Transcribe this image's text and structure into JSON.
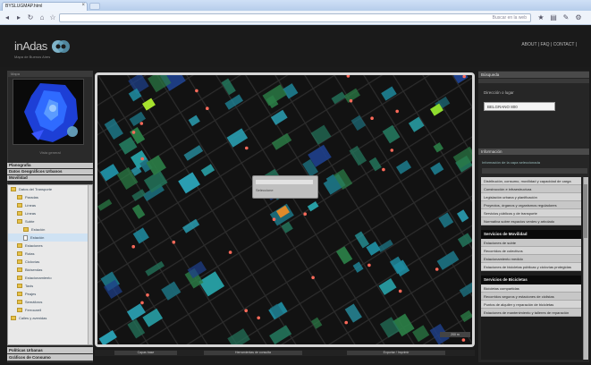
{
  "browser": {
    "tab_title": "BYSLUGMAP.html",
    "url_hint": "Buscar en la web"
  },
  "site": {
    "logo": "inAdas",
    "tagline": "Mapa de Buenos Aires",
    "nav": "ABOUT | FAQ | CONTACT |"
  },
  "left": {
    "minimap_header": "Mapa",
    "minimap_caption": "Vista general",
    "sections": [
      "Planografía",
      "Datos Geográficos Urbanos",
      "Movilidad"
    ],
    "tree": [
      {
        "label": "Datos del Transporte",
        "kind": "folder",
        "indent": 0
      },
      {
        "label": "Paradas",
        "kind": "folder",
        "indent": 1
      },
      {
        "label": "Líneas",
        "kind": "folder",
        "indent": 1
      },
      {
        "label": "Líneas",
        "kind": "folder",
        "indent": 1
      },
      {
        "label": "Subte",
        "kind": "folder",
        "indent": 1
      },
      {
        "label": "Estación",
        "kind": "folder",
        "indent": 2
      },
      {
        "label": "Estación",
        "kind": "page",
        "indent": 2,
        "selected": true
      },
      {
        "label": "Estaciones",
        "kind": "folder",
        "indent": 1
      },
      {
        "label": "Rutas",
        "kind": "folder",
        "indent": 1
      },
      {
        "label": "Ciclovías",
        "kind": "folder",
        "indent": 1
      },
      {
        "label": "Bicisendas",
        "kind": "folder",
        "indent": 1
      },
      {
        "label": "Estacionamiento",
        "kind": "folder",
        "indent": 1
      },
      {
        "label": "Taxis",
        "kind": "folder",
        "indent": 1
      },
      {
        "label": "Peajes",
        "kind": "folder",
        "indent": 1
      },
      {
        "label": "Semáforos",
        "kind": "folder",
        "indent": 1
      },
      {
        "label": "Ferrocarril",
        "kind": "folder",
        "indent": 1
      },
      {
        "label": "Calles y avenidas",
        "kind": "folder",
        "indent": 0
      }
    ],
    "bottom_sections": [
      "Políticas Urbanas",
      "Gráficos de Consumo"
    ]
  },
  "map": {
    "popup_text": "Seleccione",
    "scale": "200 m",
    "bottom_tabs": [
      "Capas base",
      "Herramientas de consulta",
      "Exportar / Imprimir"
    ]
  },
  "right": {
    "header": "Búsqueda",
    "search_label": "Dirección o lugar",
    "search_value": "BELGRANO 800",
    "info_header": "Información",
    "info_sub": "Información de la capa seleccionada",
    "items": [
      {
        "kind": "item",
        "text": "Distribución, consumo, movilidad y capacidad de carga"
      },
      {
        "kind": "item",
        "text": "Construcción e infraestructura"
      },
      {
        "kind": "item",
        "text": "Legislación urbana y planificación"
      },
      {
        "kind": "item",
        "text": "Proyectos, órganos y organismos reguladores"
      },
      {
        "kind": "item",
        "text": "Servicios públicos y de transporte"
      },
      {
        "kind": "item",
        "text": "Normativa sobre espacios verdes y arbolado"
      },
      {
        "kind": "head",
        "text": "Servicios de Movilidad"
      },
      {
        "kind": "item",
        "text": "Estaciones de subte"
      },
      {
        "kind": "item",
        "text": "Recorridos de colectivos"
      },
      {
        "kind": "item",
        "text": "Estacionamiento medido"
      },
      {
        "kind": "item",
        "text": "Estaciones de bicicletas públicas y ciclovías protegidas"
      },
      {
        "kind": "head",
        "text": "Servicios de Bicicletas"
      },
      {
        "kind": "item",
        "text": "Bicicletas compartidas"
      },
      {
        "kind": "item",
        "text": "Recorridos seguros y estaciones de ciclistas"
      },
      {
        "kind": "item",
        "text": "Puntos de alquiler y reparación de bicicletas"
      },
      {
        "kind": "item",
        "text": "Estaciones de mantenimiento y talleres de reparación"
      }
    ]
  }
}
